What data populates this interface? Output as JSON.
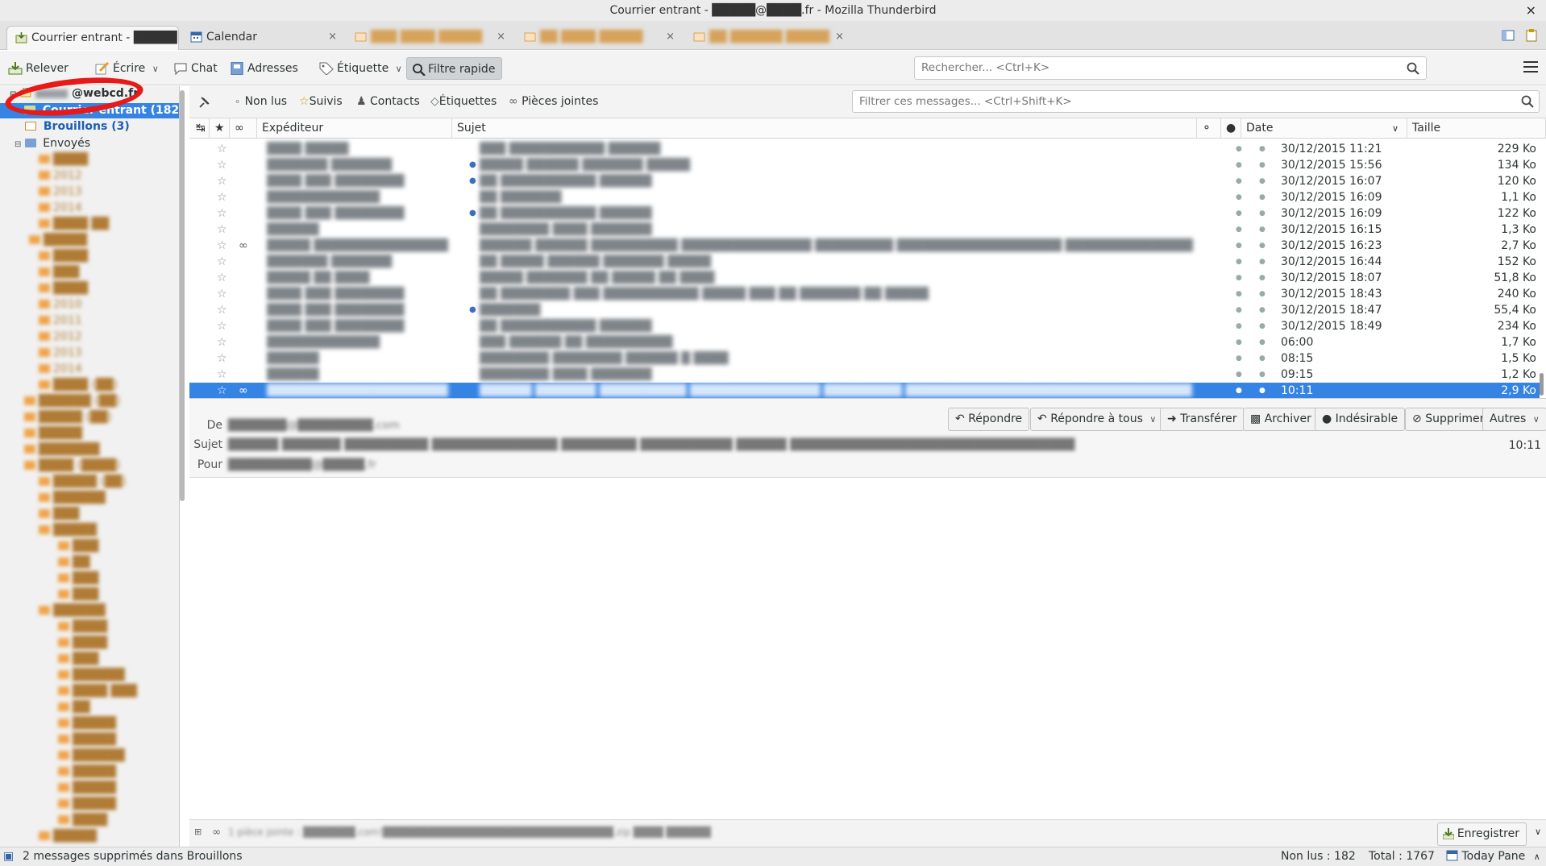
{
  "window": {
    "title": "Courrier entrant - █████@████.fr - Mozilla Thunderbird",
    "close": "×"
  },
  "tabs": [
    {
      "label": "Courrier entrant - █████",
      "active": true
    },
    {
      "label": "Calendar",
      "close": "×"
    },
    {
      "label": "███ ████ █████",
      "close": "×"
    },
    {
      "label": "██ ████ █████",
      "close": "×"
    },
    {
      "label": "██ ██████ █████",
      "close": "×"
    }
  ],
  "toolbar": {
    "get": "Relever",
    "write": "Écrire",
    "chat": "Chat",
    "address_book": "Adresses",
    "tag": "Étiquette",
    "quick_filter": "Filtre rapide",
    "search_placeholder": "Rechercher... <Ctrl+K>"
  },
  "folders": {
    "account": "@webcd.fr",
    "inbox": "Courrier entrant (182)",
    "drafts": "Brouillons (3)",
    "sent": "Envoyés",
    "blurred_items": [
      "████",
      "2012",
      "2013",
      "2014",
      "████ ██",
      "█████",
      "████",
      "███",
      "████",
      "2010",
      "2011",
      "2012",
      "2013",
      "2014",
      "████ (██)",
      "██████ (██)",
      "█████ (██)",
      "█████",
      "███████",
      "████ (████)",
      "█████ (██)",
      "██████",
      "███",
      "█████",
      "███",
      "██",
      "███",
      "███",
      "██████",
      "████",
      "████",
      "███",
      "██████",
      "████ ███",
      "██",
      "█████",
      "█████",
      "██████",
      "█████",
      "█████",
      "█████",
      "████",
      "█████"
    ]
  },
  "quickfilter": {
    "unread": "Non lus",
    "starred": "Suivis",
    "contacts": "Contacts",
    "tags": "Étiquettes",
    "attachments": "Pièces jointes",
    "filter_placeholder": "Filtrer ces messages... <Ctrl+Shift+K>"
  },
  "columns": {
    "sender": "Expéditeur",
    "subject": "Sujet",
    "date": "Date",
    "size": "Taille"
  },
  "messages": [
    {
      "sender": "████ █████",
      "subject": "███ ███████████ ██████",
      "date": "30/12/2015 11:21",
      "size": "229 Ko",
      "thread": false,
      "attach": false
    },
    {
      "sender": "███████ ███████",
      "subject": "█████ ██████ ███████ █████",
      "date": "30/12/2015 15:56",
      "size": "134 Ko",
      "thread": true,
      "attach": false
    },
    {
      "sender": "████ ███ ████████",
      "subject": "██ ███████████ ██████",
      "date": "30/12/2015 16:07",
      "size": "120 Ko",
      "thread": true,
      "attach": false
    },
    {
      "sender": "█████████████",
      "subject": "██ ███████",
      "date": "30/12/2015 16:09",
      "size": "1,1 Ko",
      "thread": false,
      "attach": false
    },
    {
      "sender": "████ ███ ████████",
      "subject": "██ ███████████ ██████",
      "date": "30/12/2015 16:09",
      "size": "122 Ko",
      "thread": true,
      "attach": false
    },
    {
      "sender": "██████",
      "subject": "████████ ████ ███████",
      "date": "30/12/2015 16:15",
      "size": "1,3 Ko",
      "thread": false,
      "attach": false
    },
    {
      "sender": "█████ ██████████████████",
      "subject": "██████ ██████ ██████████ ███████████████ █████████ ███████████████████ ████████████████",
      "date": "30/12/2015 16:23",
      "size": "2,7 Ko",
      "thread": false,
      "attach": true
    },
    {
      "sender": "███████ ███████",
      "subject": "██ █████ ██████ ███████ █████",
      "date": "30/12/2015 16:44",
      "size": "152 Ko",
      "thread": false,
      "attach": false
    },
    {
      "sender": "█████ ██ ████",
      "subject": "█████ ███████ ██ █████ ██ ████",
      "date": "30/12/2015 18:07",
      "size": "51,8 Ko",
      "thread": false,
      "attach": false
    },
    {
      "sender": "████ ███ ████████",
      "subject": "██ ████████ ███ ███████████ █████ ███ ██ ███████ ██ █████",
      "date": "30/12/2015 18:43",
      "size": "240 Ko",
      "thread": false,
      "attach": false
    },
    {
      "sender": "████ ███ ████████",
      "subject": "███████",
      "date": "30/12/2015 18:47",
      "size": "55,4 Ko",
      "thread": true,
      "attach": false
    },
    {
      "sender": "████ ███ ████████",
      "subject": "██ ███████████ ██████",
      "date": "30/12/2015 18:49",
      "size": "234 Ko",
      "thread": false,
      "attach": false
    },
    {
      "sender": "█████████████",
      "subject": "███ ██████ ██ ██████████",
      "date": "06:00",
      "size": "1,7 Ko",
      "thread": false,
      "attach": false
    },
    {
      "sender": "██████",
      "subject": "████████ ████████ ██████ █ ████",
      "date": "08:15",
      "size": "1,5 Ko",
      "thread": false,
      "attach": false
    },
    {
      "sender": "██████",
      "subject": "████████ ████ ███████",
      "date": "09:15",
      "size": "1,2 Ko",
      "thread": false,
      "attach": false
    },
    {
      "sender": "██████████████████████",
      "subject": "██████ ███████ ██████████ ███████████████ █████████ █████████████████████████████████",
      "date": "10:11",
      "size": "2,9 Ko",
      "thread": false,
      "attach": true,
      "selected": true
    }
  ],
  "message_header": {
    "from_label": "De",
    "subject_label": "Sujet",
    "to_label": "Pour",
    "from": "███████@█████████.com",
    "subject": "██████ ███████ ██████████ ███████████████ █████████ ███████████ ██████ ██████████████████████████████████",
    "to": "██████████@█████.fr",
    "time": "10:11",
    "reply": "Répondre",
    "reply_all": "Répondre à tous",
    "forward": "Transférer",
    "archive": "Archiver",
    "junk": "Indésirable",
    "delete": "Supprimer",
    "other": "Autres"
  },
  "attachment_bar": {
    "summary": "1 pièce jointe : ███████.com!███████████████████████████████.zip  ████ ██████",
    "save": "Enregistrer"
  },
  "statusbar": {
    "message": "2 messages supprimés dans Brouillons",
    "unread": "Non lus : 182",
    "total": "Total : 1767",
    "today_pane": "Today Pane"
  },
  "colors": {
    "selection": "#3584e4",
    "annotation_circle": "#e81919",
    "folder_orange": "#f0a44a"
  },
  "icons": {
    "star": "star-icon",
    "attachment": "paperclip-icon",
    "read_dot": "read-status-icon",
    "search": "search-icon"
  }
}
